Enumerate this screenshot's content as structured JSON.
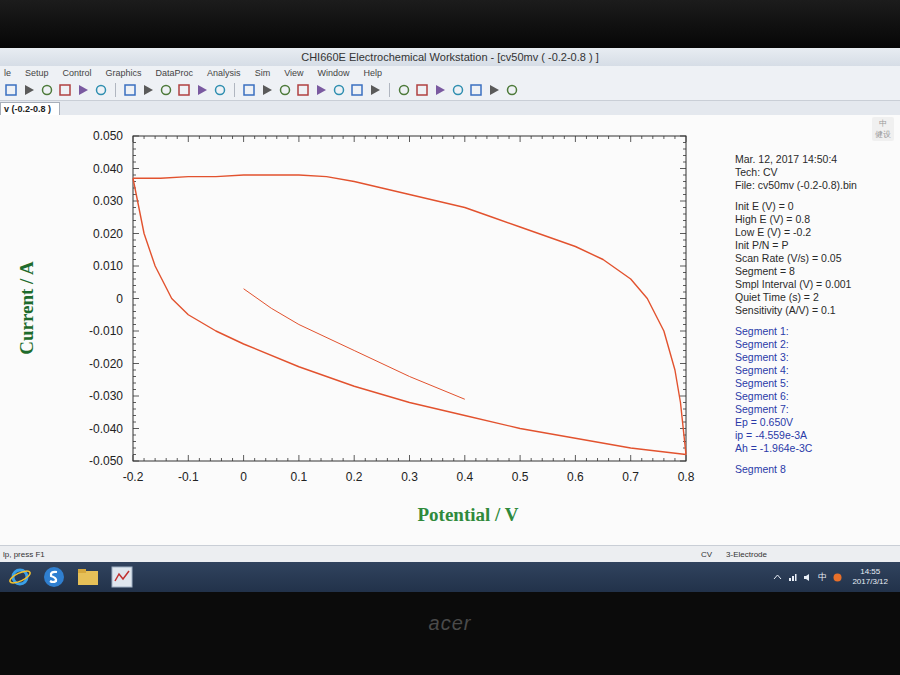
{
  "window": {
    "title": "CHI660E Electrochemical Workstation - [cv50mv ( -0.2-0.8 ) ]"
  },
  "menu": [
    "le",
    "Setup",
    "Control",
    "Graphics",
    "DataProc",
    "Analysis",
    "Sim",
    "View",
    "Window",
    "Help"
  ],
  "tabs": [
    {
      "label": "v (-0.2-0.8 )",
      "selected": true
    }
  ],
  "ime_widget": [
    "中",
    "健设"
  ],
  "chart": {
    "y_axis": {
      "title": "Current / A",
      "ticks": [
        "0.050",
        "0.040",
        "0.030",
        "0.020",
        "0.010",
        "0",
        "-0.010",
        "-0.020",
        "-0.030",
        "-0.040",
        "-0.050"
      ]
    },
    "x_axis": {
      "title": "Potential / V",
      "ticks": [
        "-0.2",
        "-0.1",
        "0",
        "0.1",
        "0.2",
        "0.3",
        "0.4",
        "0.5",
        "0.6",
        "0.7",
        "0.8"
      ]
    },
    "series": [
      {
        "potential": [
          0,
          0.05,
          0.1,
          0.2,
          0.3,
          0.4
        ],
        "current": [
          0.003,
          -0.003,
          -0.008,
          -0.016,
          -0.024,
          -0.031
        ]
      },
      {
        "potential": [
          -0.2,
          -0.15,
          -0.1,
          -0.05,
          0,
          0.05,
          0.1,
          0.15,
          0.2,
          0.25,
          0.3,
          0.35,
          0.4,
          0.45,
          0.5,
          0.55,
          0.6,
          0.65,
          0.7,
          0.73,
          0.76,
          0.78,
          0.79,
          0.8
        ],
        "current": [
          0.037,
          0.037,
          0.0375,
          0.0375,
          0.038,
          0.038,
          0.038,
          0.0375,
          0.036,
          0.034,
          0.032,
          0.03,
          0.028,
          0.025,
          0.022,
          0.019,
          0.016,
          0.012,
          0.006,
          0.0,
          -0.01,
          -0.022,
          -0.032,
          -0.048
        ]
      },
      {
        "potential": [
          0.8,
          0.7,
          0.6,
          0.5,
          0.4,
          0.3,
          0.2,
          0.1,
          0.0,
          -0.05,
          -0.1,
          -0.13,
          -0.16,
          -0.18,
          -0.2
        ],
        "current": [
          -0.048,
          -0.046,
          -0.043,
          -0.04,
          -0.036,
          -0.032,
          -0.027,
          -0.021,
          -0.014,
          -0.01,
          -0.005,
          0.0,
          0.01,
          0.02,
          0.037
        ]
      }
    ]
  },
  "info": {
    "header": [
      "Mar. 12, 2017   14:50:4",
      "Tech: CV",
      "File: cv50mv (-0.2-0.8).bin"
    ],
    "params": [
      "Init E (V) = 0",
      "High E (V) = 0.8",
      "Low E (V) = -0.2",
      "Init P/N = P",
      "Scan Rate (V/s) = 0.05",
      "Segment = 8",
      "Smpl Interval (V) = 0.001",
      "Quiet Time (s) = 2",
      "Sensitivity (A/V) = 0.1"
    ],
    "segments": [
      "Segment 1:",
      "Segment 2:",
      "Segment 3:",
      "Segment 4:",
      "Segment 5:",
      "Segment 6:",
      "Segment 7:"
    ],
    "peak": [
      "Ep = 0.650V",
      "ip = -4.559e-3A",
      "Ah = -1.964e-3C"
    ],
    "last_segment": "Segment 8"
  },
  "status_bar": {
    "hint": "lp, press F1",
    "technique": "CV",
    "mode": "3-Electrode"
  },
  "taskbar": {
    "tray": [
      "中"
    ],
    "time": "14:55",
    "date": "2017/3/12"
  },
  "bezel": {
    "logo": "acer"
  }
}
